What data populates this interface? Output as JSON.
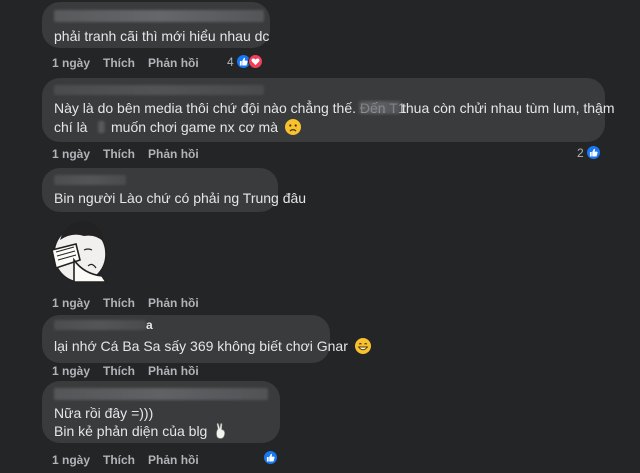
{
  "labels": {
    "like": "Thích",
    "reply": "Phản hồi"
  },
  "comments": [
    {
      "text_lines": [
        "phải tranh cãi thì mới hiểu nhau dc"
      ],
      "time": "1 ngày",
      "reaction_count": "4",
      "reactions": [
        "like-icon",
        "love-icon"
      ]
    },
    {
      "text_lines": [
        "Này là do bên media thôi chứ đội nào chẳng thế. Đến T1",
        "thua còn chửi nhau tùm lum, thậm",
        "chí là",
        "muốn chơi game nx cơ mà"
      ],
      "time": "1 ngày",
      "reaction_count": "2",
      "reactions": [
        "like-icon"
      ],
      "emoji": "sad-face-emoji"
    },
    {
      "text_lines": [
        "Bin người Lào chứ có phải ng Trung đâu"
      ],
      "time": "1 ngày",
      "sticker": "facepalm-sticker"
    },
    {
      "name_suffix": "a",
      "text_lines": [
        "lại nhớ Cá Ba Sa sấy 369 không biết chơi Gnar"
      ],
      "time": "1 ngày",
      "emoji": "grin-face-emoji"
    },
    {
      "text_lines": [
        "Nữa rồi đây =)))",
        "Bin kẻ phản diện của blg"
      ],
      "time": "1 ngày",
      "reactions": [
        "like-icon"
      ],
      "emoji": "peace-hand-emoji"
    }
  ],
  "colors": {
    "background": "#242526",
    "bubble": "#3a3b3c",
    "text": "#e4e6eb",
    "secondary_text": "#b0b3b8",
    "like_blue": "#1877f2",
    "love_red": "#f33e58"
  }
}
